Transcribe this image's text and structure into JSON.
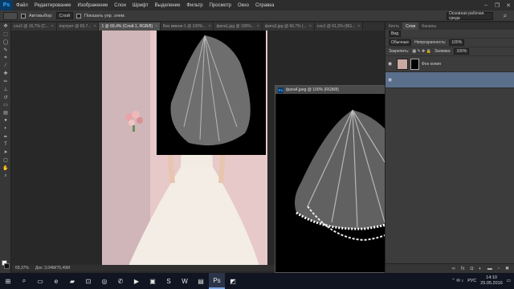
{
  "menu": {
    "logo": "Ps",
    "items": [
      "Файл",
      "Редактирование",
      "Изображение",
      "Слои",
      "Шрифт",
      "Выделение",
      "Фильтр",
      "Просмотр",
      "Окно",
      "Справка"
    ],
    "window_controls": [
      "–",
      "❐",
      "✕"
    ]
  },
  "options": {
    "autoselect_label": "Автовыбор:",
    "autoselect_value": "Слой",
    "show_transform_label": "Показать упр. элем.",
    "workspace": "Основная рабочая среда"
  },
  "tabs": [
    {
      "label": "сон2 @ 16,7% (С...",
      "active": false
    },
    {
      "label": "портрет @ 65,7...",
      "active": false
    },
    {
      "label": "1 @ 69,4% (Слой 1, RGB/8)",
      "active": true
    },
    {
      "label": "Без имени-1 @ 100%...",
      "active": false
    },
    {
      "label": "фата1.jpg @ 100%...",
      "active": false
    },
    {
      "label": "фата3.jpg @ 66,7% (...",
      "active": false
    },
    {
      "label": "сон1 @ 61,5% (RG...",
      "active": false
    }
  ],
  "status": {
    "zoom": "69,37%",
    "doc_size": "Док: 3,04М/76,49М"
  },
  "float_window": {
    "title": "фата4.jpeg @ 100% (RGB/8)",
    "controls": [
      "–",
      "□",
      "✕"
    ]
  },
  "panel": {
    "tabs": [
      "Кисть",
      "Слои",
      "Каналы"
    ],
    "active_tab": "Слои",
    "kind_label": "Вид",
    "blend_mode": "Обычные",
    "opacity_label": "Непрозрачность:",
    "opacity_value": "100%",
    "lock_label": "Закрепить:",
    "fill_label": "Заливка:",
    "fill_value": "100%",
    "layers": [
      {
        "name": "Фон копия",
        "selected": false
      },
      {
        "name": "",
        "selected": true
      }
    ]
  },
  "taskbar": {
    "icons": [
      "windows-icon",
      "search-icon",
      "task-view-icon",
      "edge-icon",
      "explorer-icon",
      "store-icon",
      "chrome-icon",
      "viber-icon",
      "media-icon",
      "video-icon",
      "skype-icon",
      "word-icon",
      "folder-icon",
      "photoshop-icon",
      "photos-icon"
    ],
    "active_index": 13,
    "tray": {
      "lang": "РУС",
      "time": "14:10",
      "date": "25.05.2016"
    }
  },
  "colors": {
    "accent": "#31a8ff",
    "selected_layer": "#5a6f8c",
    "canvas_bg": "#282828",
    "panel_bg": "#3c3c3c",
    "taskbar_bg": "#101521"
  }
}
